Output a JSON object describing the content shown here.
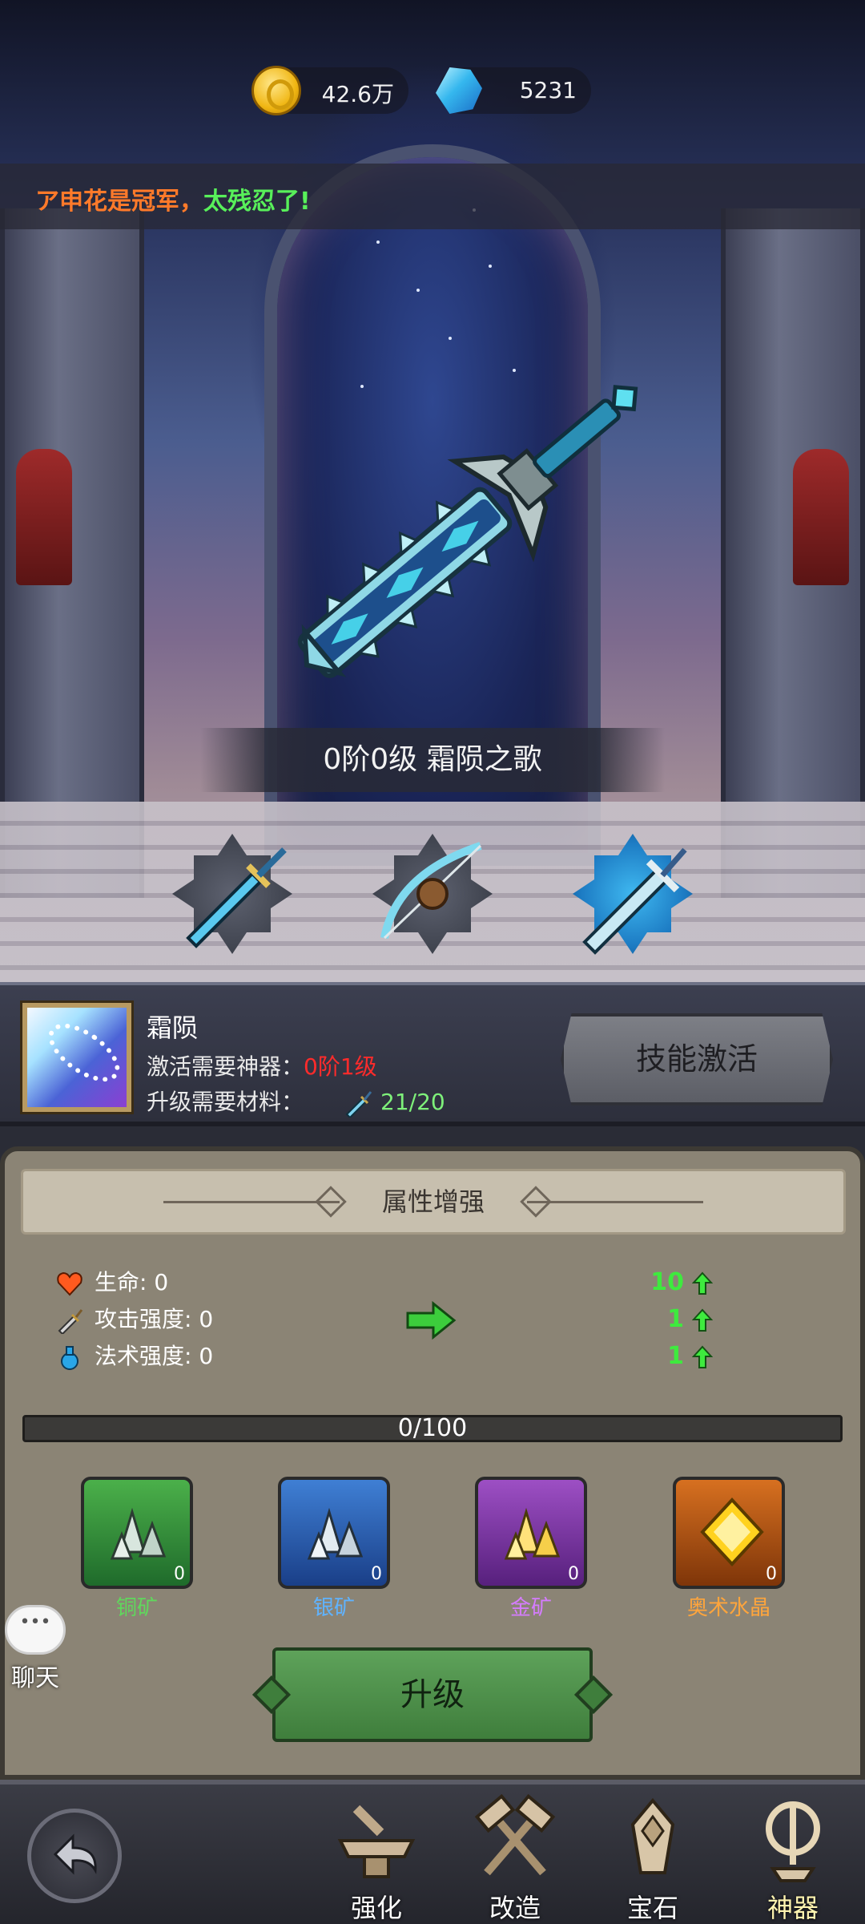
{
  "currency": {
    "gold": "42.6万",
    "gems": "5231"
  },
  "ticker": {
    "part1": "ア申花是冠军，",
    "part2": "太残忍了!"
  },
  "artifact": {
    "title": "0阶0级 霜陨之歌"
  },
  "slots": [
    {
      "name": "dagger",
      "active": false
    },
    {
      "name": "bow",
      "active": false
    },
    {
      "name": "sword",
      "active": true
    }
  ],
  "skill": {
    "name": "霜陨",
    "activate_label": "激活需要神器：",
    "activate_value": "0阶1级",
    "upgrade_label": "升级需要材料：",
    "upgrade_count": "21/20",
    "activate_button": "技能激活"
  },
  "attributes": {
    "header": "属性增强",
    "stats": [
      {
        "label": "生命: 0",
        "gain": "10",
        "icon": "heart-icon"
      },
      {
        "label": "攻击强度: 0",
        "gain": "1",
        "icon": "sword-icon"
      },
      {
        "label": "法术强度: 0",
        "gain": "1",
        "icon": "potion-icon"
      }
    ],
    "progress_text": "0/100",
    "progress_fraction": 0
  },
  "materials": [
    {
      "label": "铜矿",
      "count": "0"
    },
    {
      "label": "银矿",
      "count": "0"
    },
    {
      "label": "金矿",
      "count": "0"
    },
    {
      "label": "奥术水晶",
      "count": "0"
    }
  ],
  "upgrade_button": "升级",
  "chat_label": "聊天",
  "nav": [
    {
      "label": "强化"
    },
    {
      "label": "改造"
    },
    {
      "label": "宝石"
    },
    {
      "label": "神器"
    }
  ],
  "colors": {
    "requirement_red": "#ff2b2b",
    "count_green": "#7ef07a",
    "gain_green": "#3eea3e",
    "button_green": "#4f9149"
  }
}
